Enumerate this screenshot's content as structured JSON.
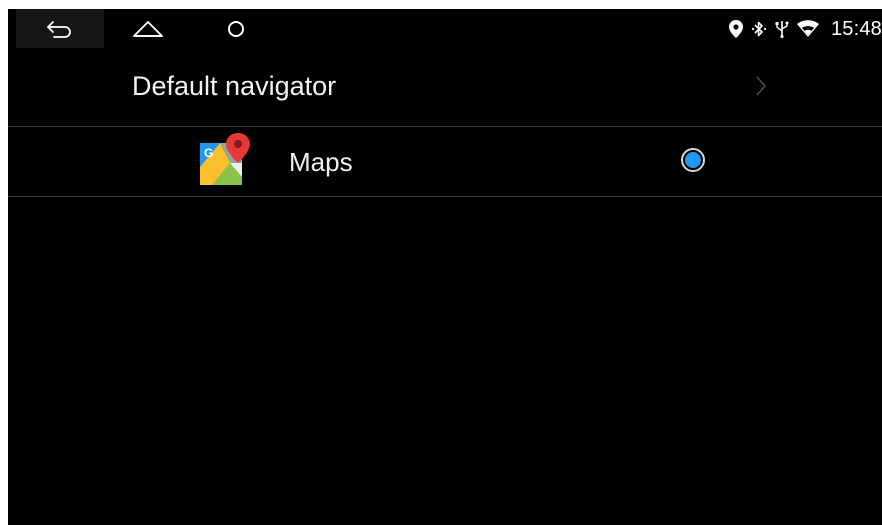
{
  "status_bar": {
    "time": "15:48",
    "icons": [
      "location-icon",
      "bluetooth-icon",
      "usb-icon",
      "wifi-icon"
    ]
  },
  "nav_bar": {
    "buttons": [
      "back-icon",
      "home-icon",
      "recent-apps-icon"
    ]
  },
  "header": {
    "title": "Default navigator"
  },
  "list": {
    "items": [
      {
        "label": "Maps",
        "icon": "google-maps-icon",
        "selected": true
      }
    ]
  },
  "colors": {
    "background": "#000000",
    "radio_accent": "#2196f3",
    "divider": "#3a3a3a",
    "text": "#f2f2f2"
  }
}
